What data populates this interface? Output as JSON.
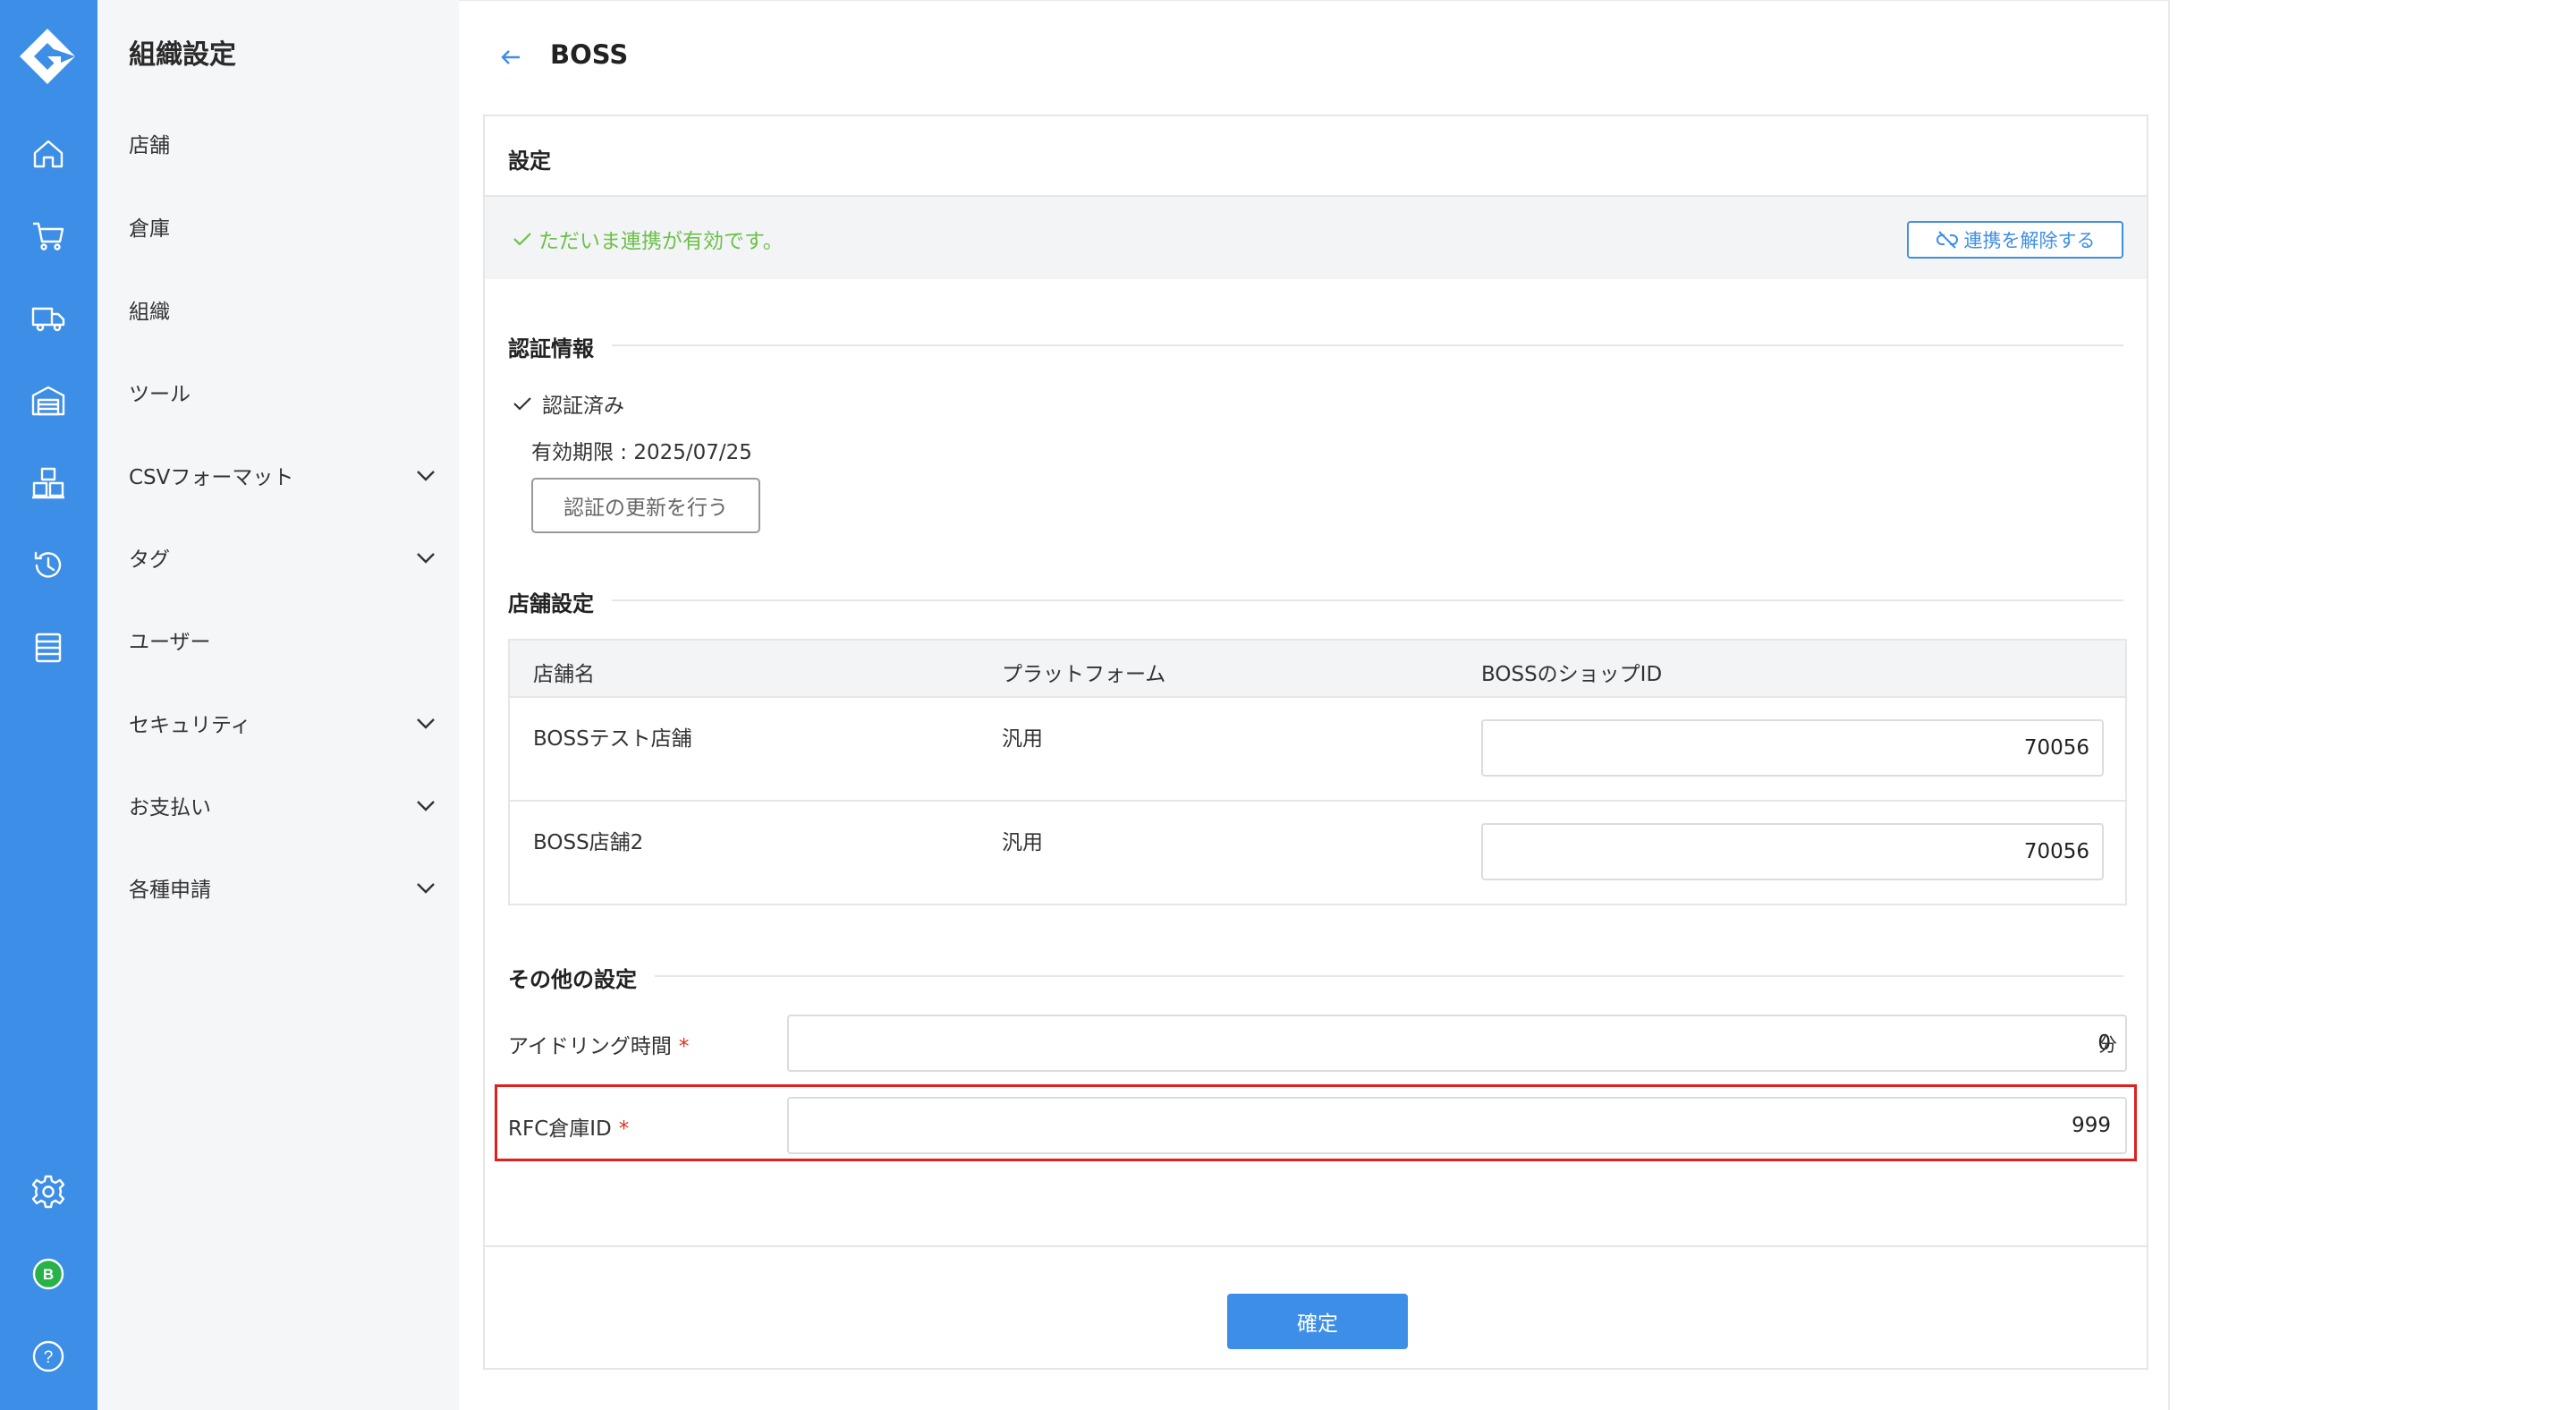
{
  "colors": {
    "brand": "#3d8ee6",
    "success": "#6cc04a",
    "required": "#e0301e",
    "highlight": "#e0201e"
  },
  "rail": {
    "items": [
      {
        "icon": "home-icon"
      },
      {
        "icon": "cart-icon"
      },
      {
        "icon": "truck-icon"
      },
      {
        "icon": "warehouse-icon"
      },
      {
        "icon": "boxes-icon"
      },
      {
        "icon": "history-icon"
      },
      {
        "icon": "list-icon"
      }
    ],
    "bottom": [
      {
        "icon": "gear-icon"
      },
      {
        "icon": "avatar-icon",
        "label": "B"
      },
      {
        "icon": "help-icon",
        "label": "?"
      }
    ]
  },
  "sidebar": {
    "title": "組織設定",
    "items": [
      {
        "label": "店舗",
        "expandable": false
      },
      {
        "label": "倉庫",
        "expandable": false
      },
      {
        "label": "組織",
        "expandable": false
      },
      {
        "label": "ツール",
        "expandable": false
      },
      {
        "label": "CSVフォーマット",
        "expandable": true
      },
      {
        "label": "タグ",
        "expandable": true
      },
      {
        "label": "ユーザー",
        "expandable": false
      },
      {
        "label": "セキュリティ",
        "expandable": true
      },
      {
        "label": "お支払い",
        "expandable": true
      },
      {
        "label": "各種申請",
        "expandable": true
      }
    ]
  },
  "header": {
    "title": "BOSS"
  },
  "card": {
    "title": "設定",
    "status_text": "ただいま連携が有効です。",
    "unlink_label": "連携を解除する"
  },
  "auth": {
    "section_title": "認証情報",
    "status": "認証済み",
    "expiry": "有効期限 : 2025/07/25",
    "renew_label": "認証の更新を行う"
  },
  "stores": {
    "section_title": "店舗設定",
    "columns": [
      "店舗名",
      "プラットフォーム",
      "BOSSのショップID"
    ],
    "rows": [
      {
        "name": "BOSSテスト店舗",
        "platform": "汎用",
        "shop_id": "70056"
      },
      {
        "name": "BOSS店舗2",
        "platform": "汎用",
        "shop_id": "70056"
      }
    ]
  },
  "other": {
    "section_title": "その他の設定",
    "idle_label": "アイドリング時間",
    "idle_value": "0",
    "idle_unit": "分",
    "rfc_label": "RFC倉庫ID",
    "rfc_value": "999",
    "required_mark": "*"
  },
  "footer": {
    "confirm_label": "確定"
  }
}
